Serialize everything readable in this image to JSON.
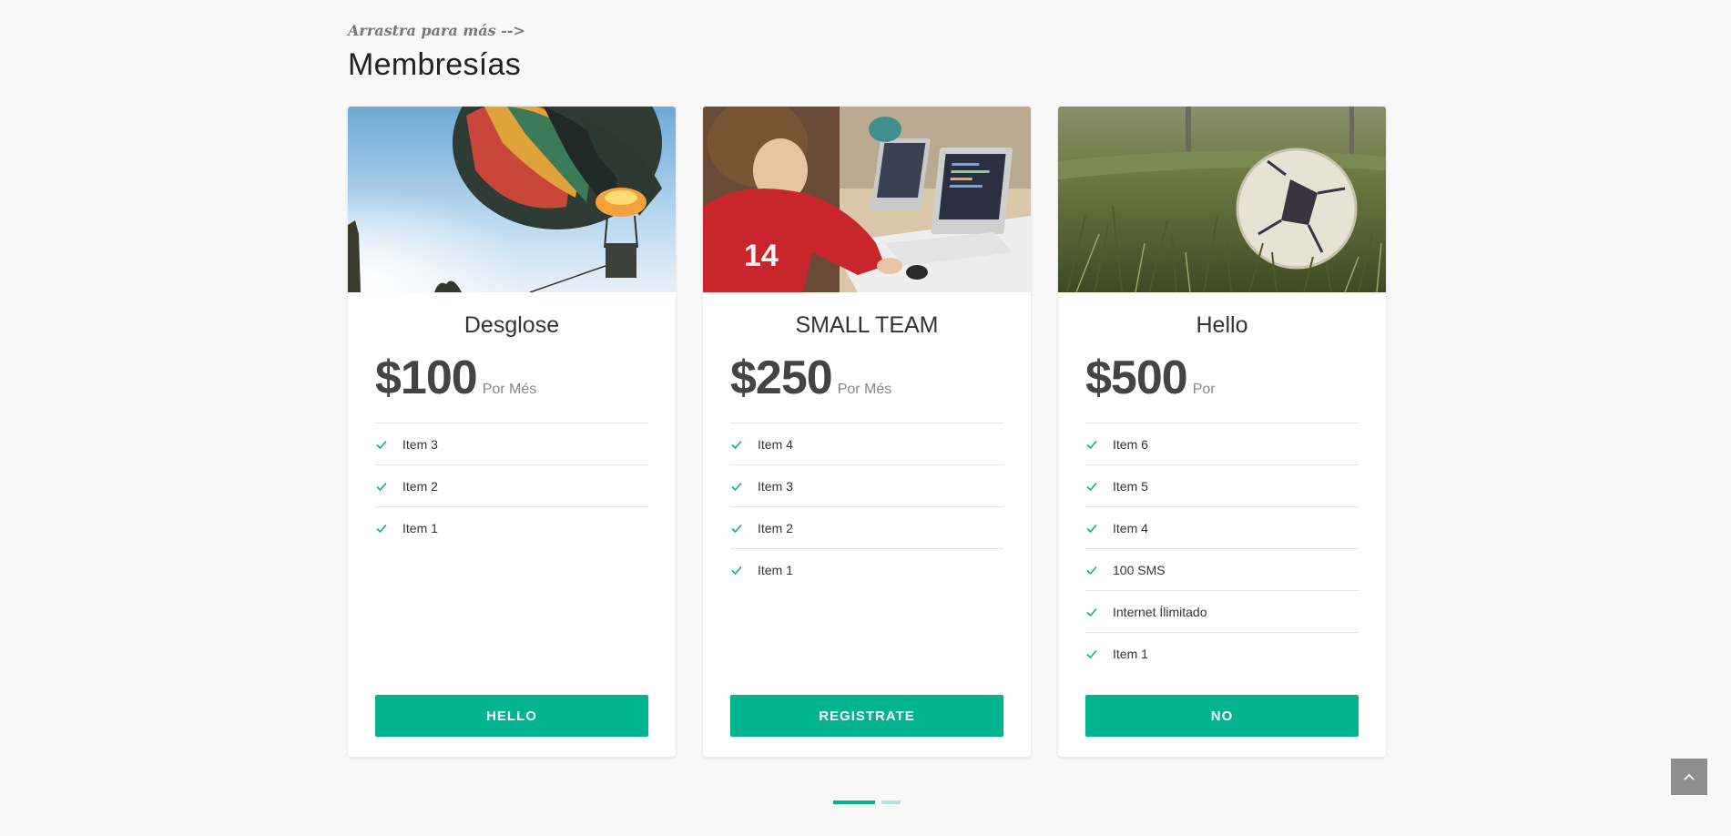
{
  "section": {
    "hint": "Arrastra para más -->",
    "title": "Membresías"
  },
  "plans": [
    {
      "name": "Desglose",
      "price": "$100",
      "period": "Por Més",
      "features": [
        "Item 3",
        "Item 2",
        "Item 1"
      ],
      "button": "HELLO"
    },
    {
      "name": "SMALL TEAM",
      "price": "$250",
      "period": "Por Més",
      "features": [
        "Item 4",
        "Item 3",
        "Item 2",
        "Item 1"
      ],
      "button": "REGISTRATE"
    },
    {
      "name": "Hello",
      "price": "$500",
      "period": "Por",
      "features": [
        "Item 6",
        "Item 5",
        "Item 4",
        "100 SMS",
        "Internet Ílimitado",
        "Item 1"
      ],
      "button": "NO"
    }
  ],
  "carousel": {
    "active_page": 1,
    "page_count": 2
  },
  "colors": {
    "accent": "#00b48f",
    "page_bg": "#f8f8f8"
  },
  "icons": {
    "check": "check-icon",
    "back_to_top": "chevron-up-icon"
  }
}
